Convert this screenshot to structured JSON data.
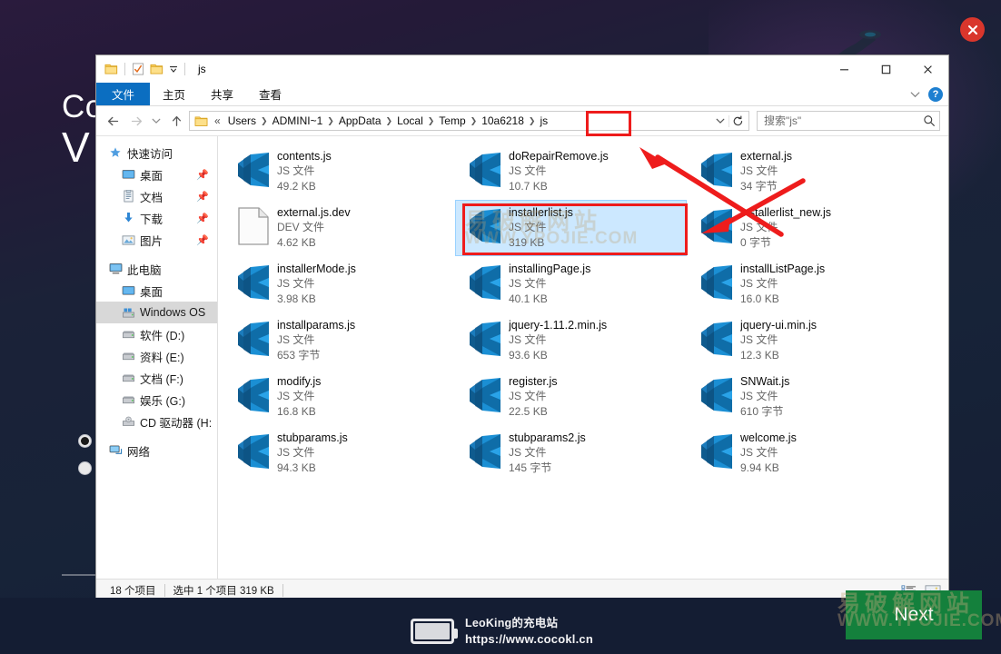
{
  "background": {
    "title_line1": "Co",
    "title_line2": "V",
    "close_icon": "close-circle-icon",
    "radio_options": [
      {
        "id": "option-1",
        "checked": true
      },
      {
        "id": "option-2",
        "checked": false
      }
    ]
  },
  "bottom": {
    "brand_name": "LeoKing的充电站",
    "brand_url": "https://www.cocokl.cn",
    "battery_icon": "battery-icon",
    "next_label": "Next"
  },
  "watermark": {
    "cn": "易破解网站",
    "en": "WWW.YPOJIE.COM"
  },
  "explorer": {
    "quick_access_toolbar": {
      "folder_icon": "folder-icon",
      "properties_icon": "properties-checkmark-icon",
      "new_folder_icon": "new-folder-icon",
      "dropdown_icon": "chevron-down-icon"
    },
    "window_title": "js",
    "window_controls": {
      "minimize": "minimize-icon",
      "maximize": "maximize-icon",
      "close": "close-icon"
    },
    "ribbon": {
      "tabs": [
        {
          "label": "文件",
          "active": true
        },
        {
          "label": "主页",
          "active": false
        },
        {
          "label": "共享",
          "active": false
        },
        {
          "label": "查看",
          "active": false
        }
      ],
      "collapse_icon": "chevron-down-icon",
      "help_label": "?"
    },
    "addressbar": {
      "back_icon": "arrow-left-icon",
      "forward_icon": "arrow-right-icon",
      "recent_icon": "chevron-down-icon",
      "up_icon": "arrow-up-icon",
      "folder_icon": "folder-icon",
      "overflow": "«",
      "crumbs": [
        "Users",
        "ADMINI~1",
        "AppData",
        "Local",
        "Temp",
        "10a6218",
        "js"
      ],
      "dropdown_icon": "chevron-down-icon",
      "refresh_icon": "refresh-icon",
      "search_placeholder": "搜索\"js\"",
      "search_value": "",
      "search_icon": "search-icon"
    },
    "navpane": {
      "sections": [
        {
          "title": "快速访问",
          "icon": "star-icon",
          "items": [
            {
              "label": "桌面",
              "icon": "desktop-icon",
              "pinned": true
            },
            {
              "label": "文档",
              "icon": "documents-icon",
              "pinned": true
            },
            {
              "label": "下载",
              "icon": "downloads-icon",
              "pinned": true
            },
            {
              "label": "图片",
              "icon": "pictures-icon",
              "pinned": true
            }
          ]
        },
        {
          "title": "此电脑",
          "icon": "this-pc-icon",
          "items": [
            {
              "label": "桌面",
              "icon": "desktop-icon",
              "pinned": false
            },
            {
              "label": "Windows OS",
              "icon": "drive-windows-icon",
              "pinned": false,
              "selected": true
            },
            {
              "label": "软件 (D:)",
              "icon": "drive-icon",
              "pinned": false
            },
            {
              "label": "资料 (E:)",
              "icon": "drive-icon",
              "pinned": false
            },
            {
              "label": "文档 (F:)",
              "icon": "drive-icon",
              "pinned": false
            },
            {
              "label": "娱乐 (G:)",
              "icon": "drive-icon",
              "pinned": false
            },
            {
              "label": "CD 驱动器 (H:",
              "icon": "cd-drive-icon",
              "pinned": false
            }
          ]
        },
        {
          "title": "网络",
          "icon": "network-icon",
          "items": []
        }
      ]
    },
    "files": [
      {
        "name": "contents.js",
        "type": "JS 文件",
        "size": "49.2 KB",
        "icon": "js-file-icon",
        "selected": false
      },
      {
        "name": "doRepairRemove.js",
        "type": "JS 文件",
        "size": "10.7 KB",
        "icon": "js-file-icon",
        "selected": false
      },
      {
        "name": "external.js",
        "type": "JS 文件",
        "size": "34 字节",
        "icon": "js-file-icon",
        "selected": false
      },
      {
        "name": "external.js.dev",
        "type": "DEV 文件",
        "size": "4.62 KB",
        "icon": "generic-file-icon",
        "selected": false
      },
      {
        "name": "installerlist.js",
        "type": "JS 文件",
        "size": "319 KB",
        "icon": "js-file-icon",
        "selected": true
      },
      {
        "name": "installerlist_new.js",
        "type": "JS 文件",
        "size": "0 字节",
        "icon": "js-file-icon",
        "selected": false
      },
      {
        "name": "installerMode.js",
        "type": "JS 文件",
        "size": "3.98 KB",
        "icon": "js-file-icon",
        "selected": false
      },
      {
        "name": "installingPage.js",
        "type": "JS 文件",
        "size": "40.1 KB",
        "icon": "js-file-icon",
        "selected": false
      },
      {
        "name": "installListPage.js",
        "type": "JS 文件",
        "size": "16.0 KB",
        "icon": "js-file-icon",
        "selected": false
      },
      {
        "name": "installparams.js",
        "type": "JS 文件",
        "size": "653 字节",
        "icon": "js-file-icon",
        "selected": false
      },
      {
        "name": "jquery-1.11.2.min.js",
        "type": "JS 文件",
        "size": "93.6 KB",
        "icon": "js-file-icon",
        "selected": false
      },
      {
        "name": "jquery-ui.min.js",
        "type": "JS 文件",
        "size": "12.3 KB",
        "icon": "js-file-icon",
        "selected": false
      },
      {
        "name": "modify.js",
        "type": "JS 文件",
        "size": "16.8 KB",
        "icon": "js-file-icon",
        "selected": false
      },
      {
        "name": "register.js",
        "type": "JS 文件",
        "size": "22.5 KB",
        "icon": "js-file-icon",
        "selected": false
      },
      {
        "name": "SNWait.js",
        "type": "JS 文件",
        "size": "610 字节",
        "icon": "js-file-icon",
        "selected": false
      },
      {
        "name": "stubparams.js",
        "type": "JS 文件",
        "size": "94.3 KB",
        "icon": "js-file-icon",
        "selected": false
      },
      {
        "name": "stubparams2.js",
        "type": "JS 文件",
        "size": "145 字节",
        "icon": "js-file-icon",
        "selected": false
      },
      {
        "name": "welcome.js",
        "type": "JS 文件",
        "size": "9.94 KB",
        "icon": "js-file-icon",
        "selected": false
      }
    ],
    "statusbar": {
      "item_count": "18 个项目",
      "selection": "选中 1 个项目  319 KB",
      "details_view_icon": "details-view-icon",
      "large_icons_view_icon": "large-icons-view-icon"
    }
  },
  "annotations": {
    "box_address_js": "red-highlight-box-js-crumb",
    "box_selected_file": "red-highlight-box-installerlist",
    "arrow_to_address": "red-arrow-to-address-js",
    "arrow_to_file": "red-arrow-to-selected-file"
  },
  "colors": {
    "accent_blue": "#0b6ec1",
    "selection_blue": "#cce8ff",
    "annotation_red": "#ee1c1c",
    "next_green": "#14803c",
    "bg_navy": "#141d33"
  }
}
